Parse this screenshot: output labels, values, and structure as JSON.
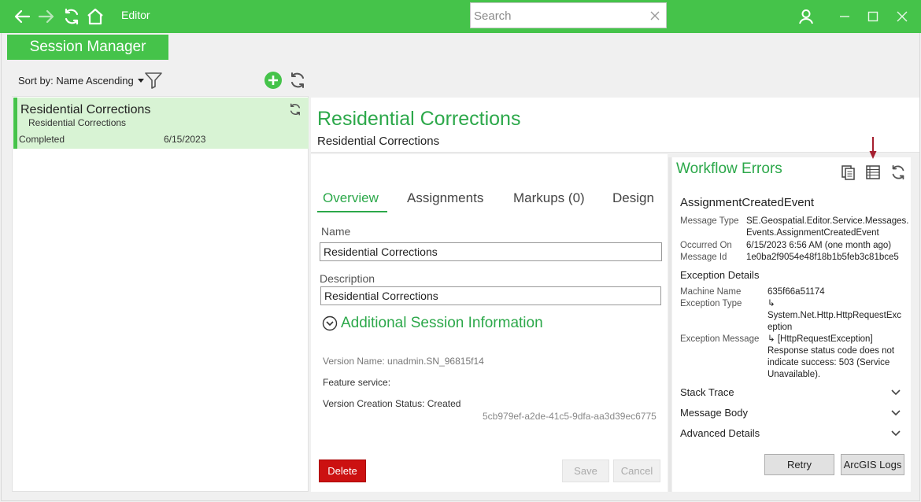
{
  "titlebar": {
    "app_title": "Editor",
    "search_placeholder": "Search",
    "accent": "#45c34a"
  },
  "session_manager": {
    "header": "Session Manager",
    "sort_label": "Sort by: Name Ascending",
    "sessions": [
      {
        "title": "Residential Corrections",
        "subtitle": "Residential Corrections",
        "status": "Completed",
        "date": "6/15/2023"
      }
    ]
  },
  "detail": {
    "title": "Residential Corrections",
    "subtitle": "Residential Corrections",
    "tabs": [
      "Overview",
      "Assignments",
      "Markups (0)",
      "Design"
    ],
    "active_tab": "Overview",
    "name_label": "Name",
    "name_value": "Residential Corrections",
    "description_label": "Description",
    "description_value": "Residential Corrections",
    "additional_info_title": "Additional Session Information",
    "version_name": "Version Name:  unadmin.SN_96815f14",
    "feature_service": "Feature service:",
    "version_creation_status": "Version Creation Status: Created",
    "guid": "5cb979ef-a2de-41c5-9dfa-aa3d39ec6775",
    "delete_label": "Delete",
    "save_label": "Save",
    "cancel_label": "Cancel"
  },
  "workflow_errors": {
    "title": "Workflow Errors",
    "event_name": "AssignmentCreatedEvent",
    "message_type_label": "Message Type",
    "message_type_value_1": "SE.Geospatial.Editor.Service.Messages.",
    "message_type_value_2": "Events.AssignmentCreatedEvent",
    "occurred_on_label": "Occurred On",
    "occurred_on_value": "6/15/2023 6:56 AM (one month ago)",
    "message_id_label": "Message Id",
    "message_id_value": "1e0ba2f9054e48f18b1b5feb3c81bce5",
    "exception_details_title": "Exception Details",
    "machine_name_label": "Machine Name",
    "machine_name_value": "635f66a51174",
    "exception_type_label": "Exception Type",
    "exception_type_value_1": "↳",
    "exception_type_value_2": "System.Net.Http.HttpRequestExc",
    "exception_type_value_3": "eption",
    "exception_message_label": "Exception Message",
    "exception_message_value_1": "↳ [HttpRequestException]",
    "exception_message_value_2": "Response status code does not",
    "exception_message_value_3": "indicate success: 503 (Service",
    "exception_message_value_4": "Unavailable).",
    "sections": [
      "Stack Trace",
      "Message Body",
      "Advanced Details"
    ],
    "retry_label": "Retry",
    "logs_label": "ArcGIS Logs"
  }
}
